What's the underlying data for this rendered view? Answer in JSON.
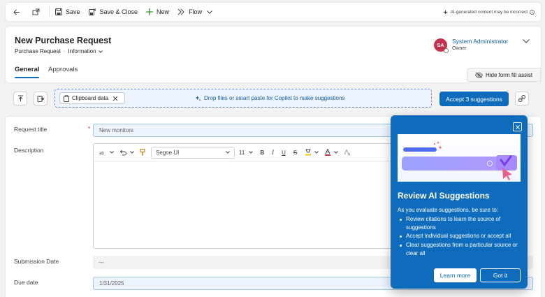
{
  "command_bar": {
    "back_icon": "back-arrow-icon",
    "popout_icon": "open-in-new-window-icon",
    "save_label": "Save",
    "save_close_label": "Save & Close",
    "new_label": "New",
    "flow_label": "Flow",
    "ai_note": "AI-generated content may be incorrect"
  },
  "header": {
    "title": "New Purchase Request",
    "entity": "Purchase Request",
    "form_name": "Information",
    "owner_initials": "SA",
    "owner_name": "System Administrator",
    "owner_role": "Owner",
    "tabs": [
      {
        "label": "General"
      },
      {
        "label": "Approvals"
      }
    ],
    "hide_assist_label": "Hide form fill assist"
  },
  "assist_bar": {
    "chip_label": "Clipboard data",
    "drop_text": "Drop files or smart paste for Copilot to make suggestions",
    "accept_label": "Accept 3 suggestions"
  },
  "form": {
    "request_title": {
      "label": "Request title",
      "required_mark": "*",
      "value": "New monitors"
    },
    "description": {
      "label": "Description",
      "font": "Segoe UI",
      "size": "11"
    },
    "submission_date": {
      "label": "Submission Date",
      "value": "---"
    },
    "due_date": {
      "label": "Due date",
      "value": "1/31/2025"
    }
  },
  "popover": {
    "title": "Review AI Suggestions",
    "intro": "As you evaluate suggestions, be sure to:",
    "items": [
      "Review citations to learn the source of suggestions",
      "Accept individual suggestions or accept all",
      "Clear suggestions from a particular source or clear all"
    ],
    "learn_more_label": "Learn more",
    "got_it_label": "Got it"
  },
  "colors": {
    "accent": "#0f6cbd",
    "owner_avatar": "#c4314b",
    "ai_field_bg": "#eef4fd"
  }
}
